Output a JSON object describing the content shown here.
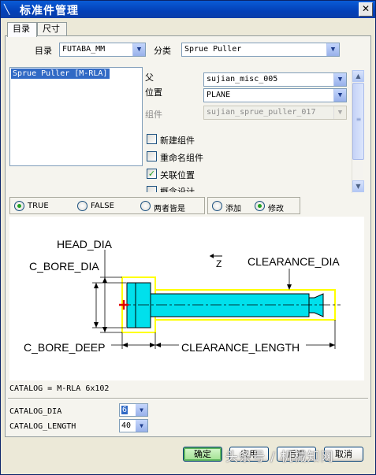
{
  "window": {
    "title": "标准件管理"
  },
  "tabs": [
    {
      "label": "目录"
    },
    {
      "label": "尺寸"
    }
  ],
  "catalog": {
    "label": "目录",
    "value": "FUTABA_MM"
  },
  "category": {
    "label": "分类",
    "value": "Sprue Puller"
  },
  "list": {
    "items": [
      "Sprue Puller [M-RLA]"
    ]
  },
  "parent": {
    "label": "父",
    "value": "sujian_misc_005"
  },
  "position": {
    "label": "位置",
    "value": "PLANE"
  },
  "component": {
    "label": "组件",
    "value": "sujian_sprue_puller_017"
  },
  "checkboxes": [
    {
      "label": "新建组件",
      "checked": false
    },
    {
      "label": "重命名组件",
      "checked": false
    },
    {
      "label": "关联位置",
      "checked": true
    },
    {
      "label": "概念设计",
      "checked": false
    }
  ],
  "radios_left": [
    {
      "label": "TRUE",
      "selected": true
    },
    {
      "label": "FALSE",
      "selected": false
    },
    {
      "label": "两者皆是",
      "selected": false
    }
  ],
  "radios_right": [
    {
      "label": "添加",
      "selected": false
    },
    {
      "label": "修改",
      "selected": true
    }
  ],
  "diagram": {
    "labels": {
      "head_dia": "HEAD_DIA",
      "c_bore_dia": "C_BORE_DIA",
      "c_bore_deep": "C_BORE_DEEP",
      "clearance_dia": "CLEARANCE_DIA",
      "clearance_length": "CLEARANCE_LENGTH",
      "axis": "Z"
    },
    "colors": {
      "body": "#00e0ec",
      "outline": "#ffff00",
      "origin": "#e00000"
    }
  },
  "catalog_line": "CATALOG = M-RLA 6x102",
  "params": [
    {
      "name": "CATALOG_DIA",
      "value": "6"
    },
    {
      "name": "CATALOG_LENGTH",
      "value": "40"
    }
  ],
  "buttons": {
    "ok": "确定",
    "apply": "应用",
    "back": "后退",
    "cancel": "取消"
  },
  "watermark": "头条号 / 机械知网"
}
